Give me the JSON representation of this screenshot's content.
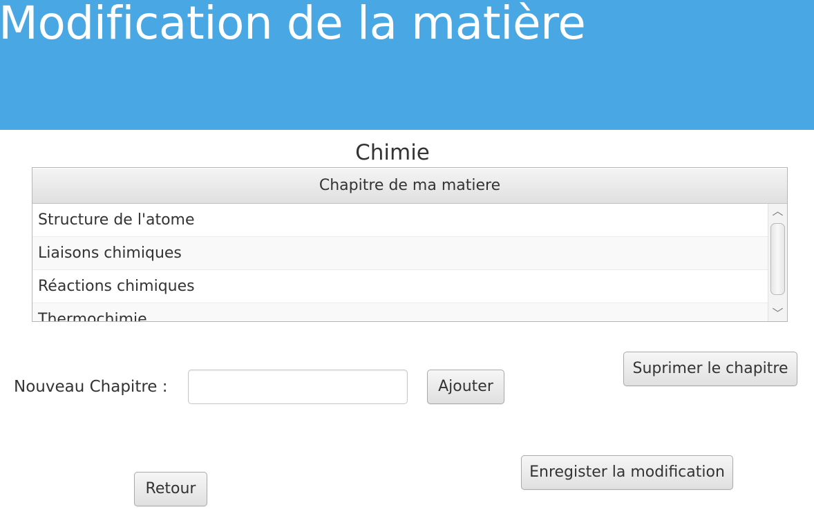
{
  "header": {
    "title": "Modification de la matière",
    "color": "#49a7e4"
  },
  "subject": {
    "name": "Chimie"
  },
  "chapters_table": {
    "column_header": "Chapitre de ma matiere",
    "rows": [
      "Structure de l'atome",
      "Liaisons chimiques",
      "Réactions chimiques",
      "Thermochimie"
    ]
  },
  "scrollbar": {
    "up_icon": "chevron-up-icon",
    "down_icon": "chevron-down-icon",
    "up_glyph": "︿",
    "down_glyph": "﹀"
  },
  "new_chapter": {
    "label": "Nouveau Chapitre :",
    "value": "",
    "add_button": "Ajouter"
  },
  "actions": {
    "delete_button": "Suprimer le chapitre",
    "save_button": "Enregister la modification",
    "back_button": "Retour"
  }
}
